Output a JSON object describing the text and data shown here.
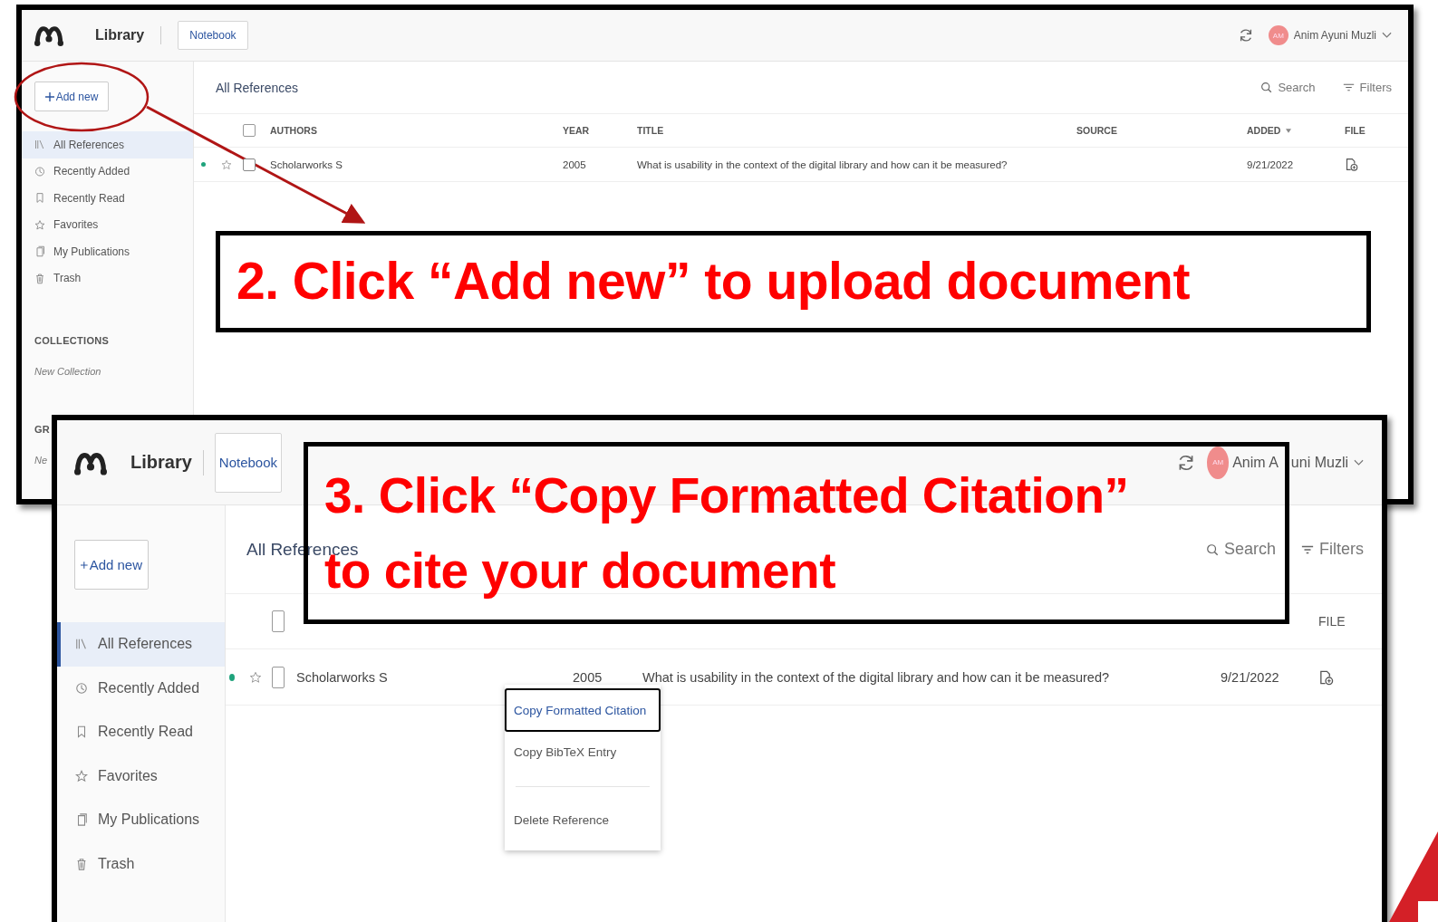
{
  "panels": [
    {
      "header": {
        "title": "Library",
        "notebook_button": "Notebook",
        "user": {
          "initials": "AM",
          "name": "Anim Ayuni Muzli"
        }
      },
      "add_button": "Add new",
      "sidebar": {
        "items": [
          {
            "label": "All References",
            "selected": true
          },
          {
            "label": "Recently Added",
            "selected": false
          },
          {
            "label": "Recently Read",
            "selected": false
          },
          {
            "label": "Favorites",
            "selected": false
          },
          {
            "label": "My Publications",
            "selected": false
          },
          {
            "label": "Trash",
            "selected": false
          }
        ],
        "sections": [
          {
            "heading": "COLLECTIONS",
            "item": "New Collection"
          },
          {
            "heading": "GR",
            "item": "Ne"
          }
        ]
      },
      "content_title": "All References",
      "search": "Search",
      "filters": "Filters",
      "all_checked": false,
      "columns": [
        {
          "label": "AUTHORS",
          "sorted": false
        },
        {
          "label": "YEAR",
          "sorted": false
        },
        {
          "label": "TITLE",
          "sorted": false
        },
        {
          "label": "SOURCE",
          "sorted": false
        },
        {
          "label": "ADDED",
          "sorted": true
        },
        {
          "label": "FILE",
          "sorted": false
        }
      ],
      "rows": [
        {
          "unread": true,
          "starred": false,
          "checked": false,
          "authors": "Scholarworks S",
          "year": "2005",
          "title": "What is usability in the context of the digital library and how can it be measured?",
          "added": "9/21/2022"
        }
      ]
    },
    {
      "header": {
        "title": "Library",
        "notebook_button": "Notebook",
        "user": {
          "initials": "AM",
          "name_parts": [
            "Anim A",
            "uni Muzli"
          ]
        }
      },
      "add_button": "Add new",
      "sidebar": {
        "items": [
          {
            "label": "All References",
            "selected": true
          },
          {
            "label": "Recently Added",
            "selected": false
          },
          {
            "label": "Recently Read",
            "selected": false
          },
          {
            "label": "Favorites",
            "selected": false
          },
          {
            "label": "My Publications",
            "selected": false
          },
          {
            "label": "Trash",
            "selected": false
          }
        ]
      },
      "content_title": "All References",
      "search": "Search",
      "filters": "Filters",
      "all_checked": false,
      "columns": [
        {
          "label": "FILE",
          "sorted": false
        }
      ],
      "rows": [
        {
          "unread": true,
          "starred": false,
          "checked": false,
          "authors": "Scholarworks S",
          "year": "2005",
          "title": "What is usability in the context of the digital library and how can it be measured?",
          "added": "9/21/2022"
        }
      ],
      "context_menu": [
        {
          "label": "Copy Formatted Citation",
          "selected": true
        },
        {
          "label": "Copy BibTeX Entry",
          "selected": false
        },
        {
          "label": "Delete Reference",
          "selected": false
        }
      ]
    }
  ],
  "callouts": [
    {
      "lines": [
        "2. Click “Add new” to upload document"
      ]
    },
    {
      "lines": [
        "3. Click “Copy Formatted Citation”",
        "to cite your document"
      ]
    }
  ]
}
